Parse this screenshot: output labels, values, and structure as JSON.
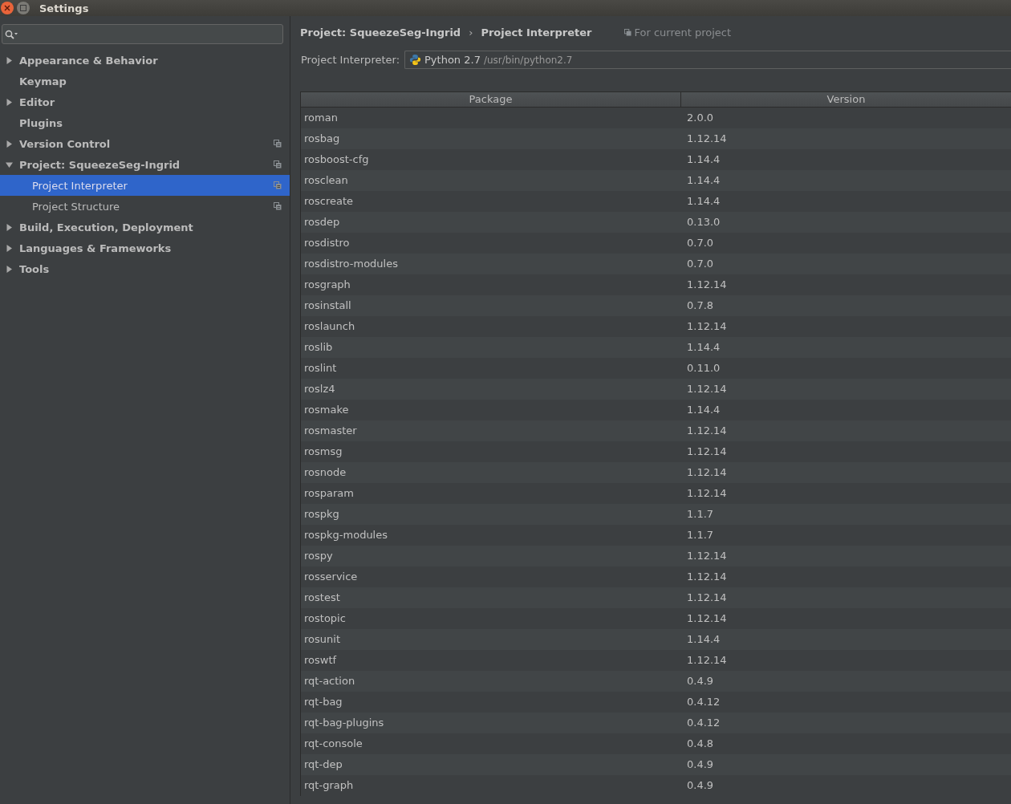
{
  "window": {
    "title": "Settings"
  },
  "sidebar": {
    "items": [
      {
        "label": "Appearance & Behavior",
        "expanded": false,
        "selected": false,
        "per_project": false
      },
      {
        "label": "Keymap",
        "selected": false,
        "per_project": false
      },
      {
        "label": "Editor",
        "expanded": false,
        "selected": false,
        "per_project": false
      },
      {
        "label": "Plugins",
        "selected": false,
        "per_project": false
      },
      {
        "label": "Version Control",
        "expanded": false,
        "selected": false,
        "per_project": true
      },
      {
        "label": "Project: SqueezeSeg-Ingrid",
        "expanded": true,
        "selected": false,
        "per_project": true,
        "children": [
          {
            "label": "Project Interpreter",
            "selected": true,
            "per_project": true
          },
          {
            "label": "Project Structure",
            "selected": false,
            "per_project": true
          }
        ]
      },
      {
        "label": "Build, Execution, Deployment",
        "expanded": false,
        "selected": false,
        "per_project": false
      },
      {
        "label": "Languages & Frameworks",
        "expanded": false,
        "selected": false,
        "per_project": false
      },
      {
        "label": "Tools",
        "expanded": false,
        "selected": false,
        "per_project": false
      }
    ]
  },
  "breadcrumb": {
    "items": [
      "Project: SqueezeSeg-Ingrid",
      "Project Interpreter"
    ],
    "separator": "›",
    "scope_note": "For current project"
  },
  "interpreter": {
    "label": "Project Interpreter:",
    "name": "Python 2.7",
    "path": "/usr/bin/python2.7"
  },
  "table": {
    "columns": [
      "Package",
      "Version"
    ],
    "rows": [
      [
        "roman",
        "2.0.0"
      ],
      [
        "rosbag",
        "1.12.14"
      ],
      [
        "rosboost-cfg",
        "1.14.4"
      ],
      [
        "rosclean",
        "1.14.4"
      ],
      [
        "roscreate",
        "1.14.4"
      ],
      [
        "rosdep",
        "0.13.0"
      ],
      [
        "rosdistro",
        "0.7.0"
      ],
      [
        "rosdistro-modules",
        "0.7.0"
      ],
      [
        "rosgraph",
        "1.12.14"
      ],
      [
        "rosinstall",
        "0.7.8"
      ],
      [
        "roslaunch",
        "1.12.14"
      ],
      [
        "roslib",
        "1.14.4"
      ],
      [
        "roslint",
        "0.11.0"
      ],
      [
        "roslz4",
        "1.12.14"
      ],
      [
        "rosmake",
        "1.14.4"
      ],
      [
        "rosmaster",
        "1.12.14"
      ],
      [
        "rosmsg",
        "1.12.14"
      ],
      [
        "rosnode",
        "1.12.14"
      ],
      [
        "rosparam",
        "1.12.14"
      ],
      [
        "rospkg",
        "1.1.7"
      ],
      [
        "rospkg-modules",
        "1.1.7"
      ],
      [
        "rospy",
        "1.12.14"
      ],
      [
        "rosservice",
        "1.12.14"
      ],
      [
        "rostest",
        "1.12.14"
      ],
      [
        "rostopic",
        "1.12.14"
      ],
      [
        "rosunit",
        "1.14.4"
      ],
      [
        "roswtf",
        "1.12.14"
      ],
      [
        "rqt-action",
        "0.4.9"
      ],
      [
        "rqt-bag",
        "0.4.12"
      ],
      [
        "rqt-bag-plugins",
        "0.4.12"
      ],
      [
        "rqt-console",
        "0.4.8"
      ],
      [
        "rqt-dep",
        "0.4.9"
      ],
      [
        "rqt-graph",
        "0.4.9"
      ]
    ]
  }
}
